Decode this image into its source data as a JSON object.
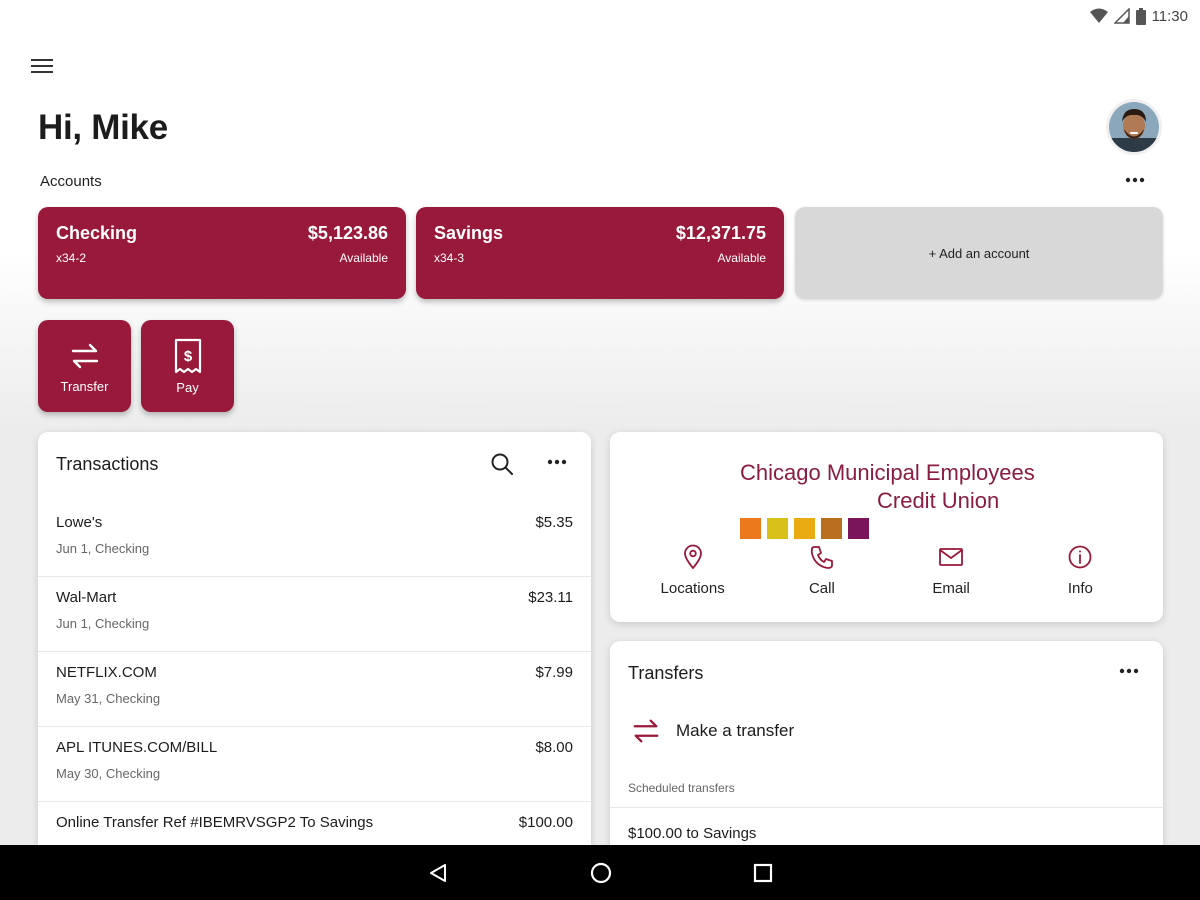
{
  "status_bar": {
    "time": "11:30"
  },
  "header": {
    "greeting": "Hi, Mike"
  },
  "accounts": {
    "label": "Accounts",
    "items": [
      {
        "name": "Checking",
        "number": "x34-2",
        "balance": "$5,123.86",
        "balance_label": "Available"
      },
      {
        "name": "Savings",
        "number": "x34-3",
        "balance": "$12,371.75",
        "balance_label": "Available"
      }
    ],
    "add_label": "+ Add an account"
  },
  "quick_actions": [
    {
      "label": "Transfer",
      "icon": "transfer-icon"
    },
    {
      "label": "Pay",
      "icon": "bill-icon"
    }
  ],
  "transactions": {
    "title": "Transactions",
    "items": [
      {
        "merchant": "Lowe's",
        "amount": "$5.35",
        "detail": "Jun 1, Checking"
      },
      {
        "merchant": "Wal-Mart",
        "amount": "$23.11",
        "detail": "Jun 1, Checking"
      },
      {
        "merchant": "NETFLIX.COM",
        "amount": "$7.99",
        "detail": "May 31, Checking"
      },
      {
        "merchant": "APL ITUNES.COM/BILL",
        "amount": "$8.00",
        "detail": "May 30, Checking"
      },
      {
        "merchant": "Online Transfer Ref #IBEMRVSGP2 To Savings",
        "amount": "$100.00",
        "detail": ""
      }
    ]
  },
  "institution": {
    "name_line1": "Chicago Municipal Employees",
    "name_line2": "Credit Union",
    "logo_colors": [
      "#ec7a1c",
      "#d9c11a",
      "#eaaa12",
      "#b86e1c",
      "#7a1559"
    ],
    "contacts": [
      {
        "label": "Locations",
        "icon": "location-pin-icon"
      },
      {
        "label": "Call",
        "icon": "phone-icon"
      },
      {
        "label": "Email",
        "icon": "email-icon"
      },
      {
        "label": "Info",
        "icon": "info-icon"
      }
    ]
  },
  "transfers": {
    "title": "Transfers",
    "make_label": "Make a transfer",
    "scheduled_label": "Scheduled transfers",
    "scheduled_items": [
      "$100.00 to Savings"
    ]
  },
  "colors": {
    "brand": "#98193a",
    "brand_text": "#8a1c43"
  }
}
